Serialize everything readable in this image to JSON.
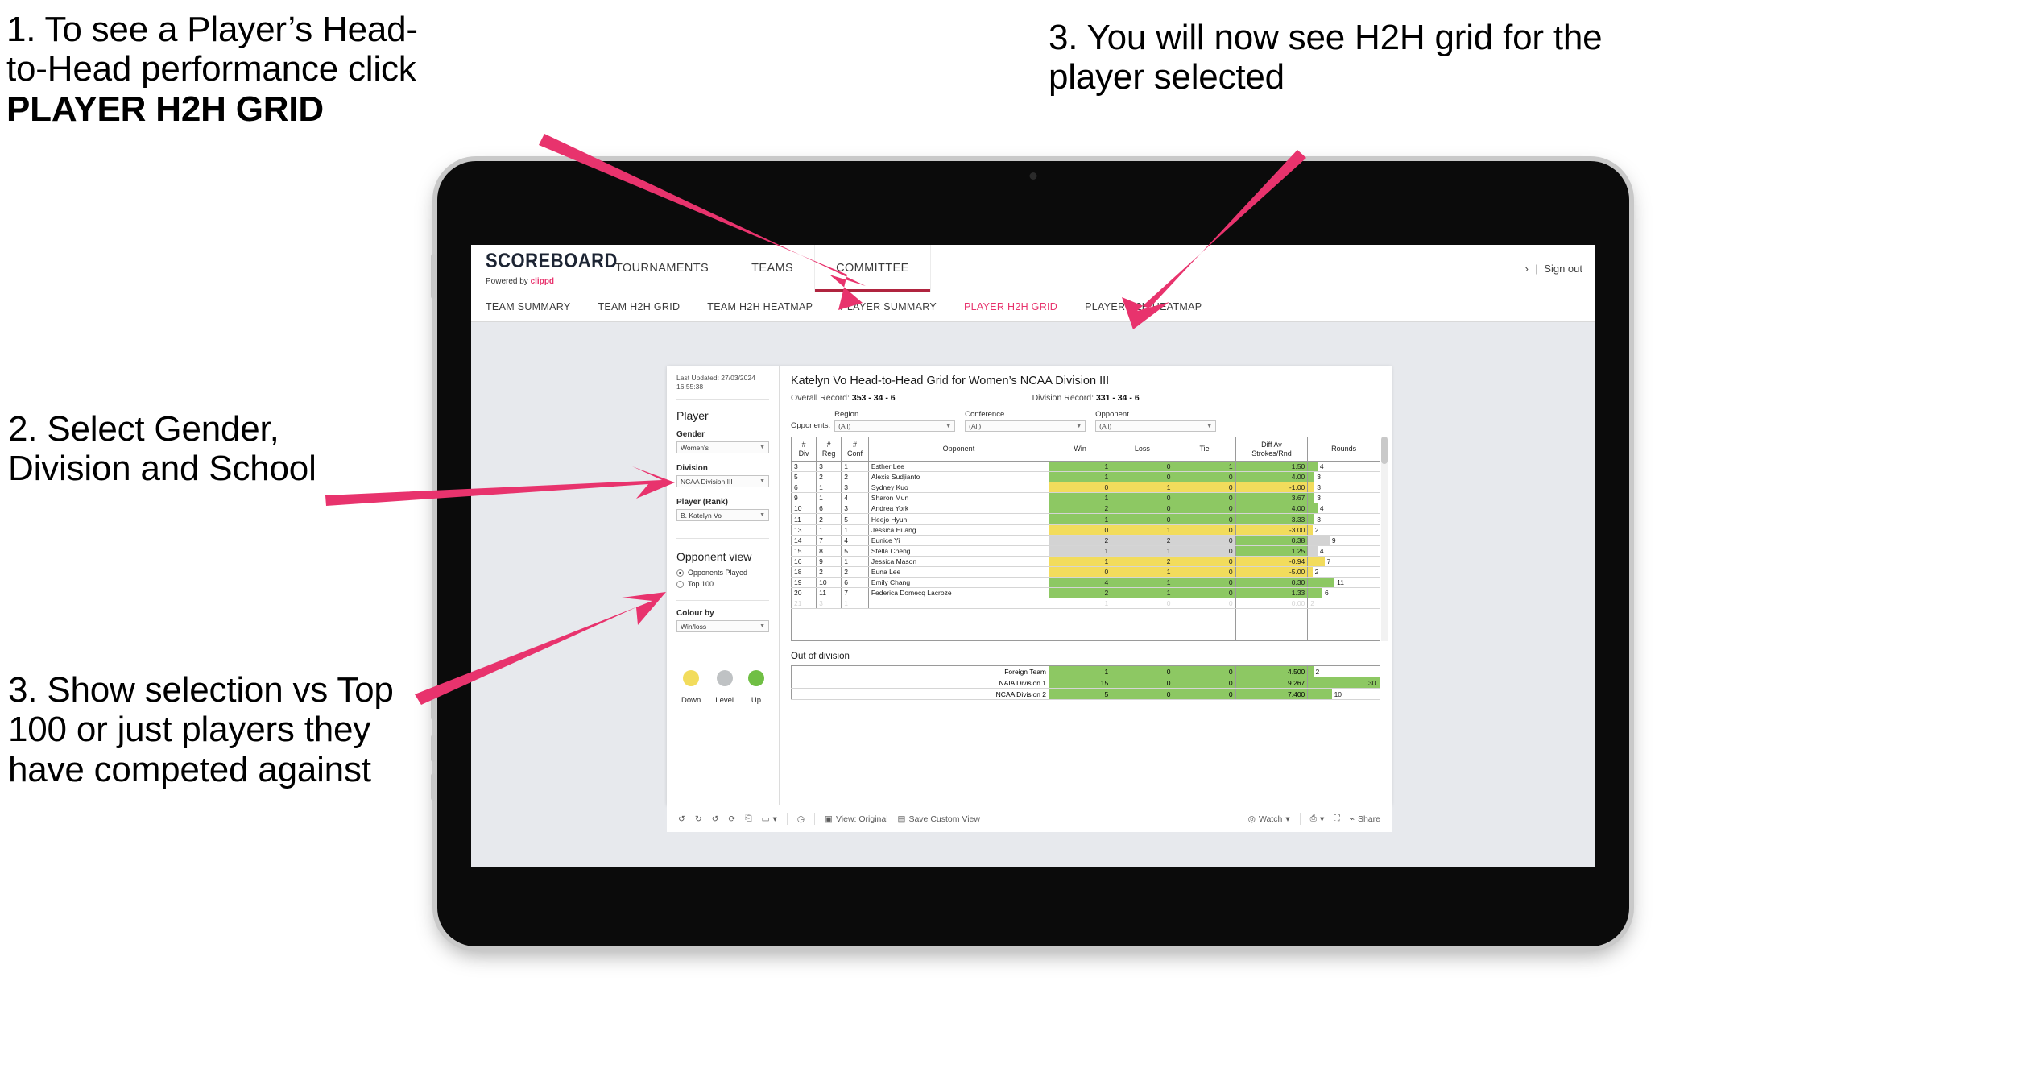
{
  "annotations": {
    "a1_line1": "1. To see a Player’s Head-",
    "a1_line2": "to-Head performance click",
    "a1_bold": "PLAYER H2H GRID",
    "a2": "2. Select Gender, Division and School",
    "a3": "3. Show selection vs Top 100 or just players they have competed against",
    "a4": "3. You will now see H2H grid for the player selected"
  },
  "app": {
    "brand": {
      "name": "SCOREBOARD",
      "powered_prefix": "Powered by ",
      "powered_brand": "clippd"
    },
    "topnav": [
      {
        "label": "TOURNAMENTS"
      },
      {
        "label": "TEAMS"
      },
      {
        "label": "COMMITTEE"
      }
    ],
    "account": {
      "chevron": "›",
      "separator": "|",
      "sign_out": "Sign out"
    },
    "subnav": [
      {
        "label": "TEAM SUMMARY",
        "selected": false
      },
      {
        "label": "TEAM H2H GRID",
        "selected": false
      },
      {
        "label": "TEAM H2H HEATMAP",
        "selected": false
      },
      {
        "label": "PLAYER SUMMARY",
        "selected": false
      },
      {
        "label": "PLAYER H2H GRID",
        "selected": true
      },
      {
        "label": "PLAYER H2H HEATMAP",
        "selected": false
      }
    ]
  },
  "sidebar": {
    "last_updated": "Last Updated: 27/03/2024 16:55:38",
    "player_heading": "Player",
    "gender": {
      "label": "Gender",
      "value": "Women's"
    },
    "division": {
      "label": "Division",
      "value": "NCAA Division III"
    },
    "player_rank": {
      "label": "Player (Rank)",
      "value": "B. Katelyn Vo"
    },
    "opponent_view": {
      "heading": "Opponent view",
      "options": [
        {
          "label": "Opponents Played",
          "selected": true
        },
        {
          "label": "Top 100",
          "selected": false
        }
      ]
    },
    "colour_by": {
      "label": "Colour by",
      "value": "Win/loss"
    },
    "legend": [
      {
        "label": "Down",
        "color": "#F2DC5C"
      },
      {
        "label": "Level",
        "color": "#BFC2C4"
      },
      {
        "label": "Up",
        "color": "#70BF44"
      }
    ]
  },
  "main": {
    "title": "Katelyn Vo Head-to-Head Grid for Women’s NCAA Division III",
    "overall_record_label": "Overall Record:",
    "overall_record_value": "353 -  34 - 6",
    "division_record_label": "Division Record:",
    "division_record_value": "331 -  34 - 6",
    "opponents_label": "Opponents:",
    "filters": [
      {
        "label": "Region",
        "value": "(All)"
      },
      {
        "label": "Conference",
        "value": "(All)"
      },
      {
        "label": "Opponent",
        "value": "(All)"
      }
    ],
    "columns": [
      "# Div",
      "# Reg",
      "# Conf",
      "Opponent",
      "Win",
      "Loss",
      "Tie",
      "Diff Av Strokes/Rnd",
      "Rounds"
    ],
    "rows": [
      {
        "div": "3",
        "reg": "3",
        "conf": "1",
        "opponent": "Esther Lee",
        "win": "1",
        "loss": "0",
        "tie": "1",
        "diff": "1.50",
        "rounds": "4",
        "color": "#8DC863",
        "bar_pct": 13
      },
      {
        "div": "5",
        "reg": "2",
        "conf": "2",
        "opponent": "Alexis Sudjianto",
        "win": "1",
        "loss": "0",
        "tie": "0",
        "diff": "4.00",
        "rounds": "3",
        "color": "#8DC863",
        "bar_pct": 9
      },
      {
        "div": "6",
        "reg": "1",
        "conf": "3",
        "opponent": "Sydney Kuo",
        "win": "0",
        "loss": "1",
        "tie": "0",
        "diff": "-1.00",
        "rounds": "3",
        "color": "#F2DC5C",
        "bar_pct": 9
      },
      {
        "div": "9",
        "reg": "1",
        "conf": "4",
        "opponent": "Sharon Mun",
        "win": "1",
        "loss": "0",
        "tie": "0",
        "diff": "3.67",
        "rounds": "3",
        "color": "#8DC863",
        "bar_pct": 9
      },
      {
        "div": "10",
        "reg": "6",
        "conf": "3",
        "opponent": "Andrea York",
        "win": "2",
        "loss": "0",
        "tie": "0",
        "diff": "4.00",
        "rounds": "4",
        "color": "#8DC863",
        "bar_pct": 13
      },
      {
        "div": "11",
        "reg": "2",
        "conf": "5",
        "opponent": "Heejo Hyun",
        "win": "1",
        "loss": "0",
        "tie": "0",
        "diff": "3.33",
        "rounds": "3",
        "color": "#8DC863",
        "bar_pct": 9
      },
      {
        "div": "13",
        "reg": "1",
        "conf": "1",
        "opponent": "Jessica Huang",
        "win": "0",
        "loss": "1",
        "tie": "0",
        "diff": "-3.00",
        "rounds": "2",
        "color": "#F2DC5C",
        "bar_pct": 6
      },
      {
        "div": "14",
        "reg": "7",
        "conf": "4",
        "opponent": "Eunice Yi",
        "win": "2",
        "loss": "2",
        "tie": "0",
        "diff": "0.38",
        "rounds": "9",
        "color": "#D3D3D3",
        "bar_pct": 30,
        "diff_color": "#8DC863"
      },
      {
        "div": "15",
        "reg": "8",
        "conf": "5",
        "opponent": "Stella Cheng",
        "win": "1",
        "loss": "1",
        "tie": "0",
        "diff": "1.25",
        "rounds": "4",
        "color": "#D3D3D3",
        "bar_pct": 13,
        "diff_color": "#8DC863"
      },
      {
        "div": "16",
        "reg": "9",
        "conf": "1",
        "opponent": "Jessica Mason",
        "win": "1",
        "loss": "2",
        "tie": "0",
        "diff": "-0.94",
        "rounds": "7",
        "color": "#F2DC5C",
        "bar_pct": 23
      },
      {
        "div": "18",
        "reg": "2",
        "conf": "2",
        "opponent": "Euna Lee",
        "win": "0",
        "loss": "1",
        "tie": "0",
        "diff": "-5.00",
        "rounds": "2",
        "color": "#F2DC5C",
        "bar_pct": 6
      },
      {
        "div": "19",
        "reg": "10",
        "conf": "6",
        "opponent": "Emily Chang",
        "win": "4",
        "loss": "1",
        "tie": "0",
        "diff": "0.30",
        "rounds": "11",
        "color": "#8DC863",
        "bar_pct": 37
      },
      {
        "div": "20",
        "reg": "11",
        "conf": "7",
        "opponent": "Federica Domecq Lacroze",
        "win": "2",
        "loss": "1",
        "tie": "0",
        "diff": "1.33",
        "rounds": "6",
        "color": "#8DC863",
        "bar_pct": 20
      }
    ],
    "out_of_division": {
      "heading": "Out of division",
      "rows": [
        {
          "name": "Foreign Team",
          "win": "1",
          "loss": "0",
          "tie": "0",
          "diff": "4.500",
          "rounds": "2",
          "color": "#8DC863",
          "bar_pct": 7
        },
        {
          "name": "NAIA Division 1",
          "win": "15",
          "loss": "0",
          "tie": "0",
          "diff": "9.267",
          "rounds": "30",
          "color": "#8DC863",
          "bar_pct": 100
        },
        {
          "name": "NCAA Division 2",
          "win": "5",
          "loss": "0",
          "tie": "0",
          "diff": "7.400",
          "rounds": "10",
          "color": "#8DC863",
          "bar_pct": 33
        }
      ]
    }
  },
  "toolbar": {
    "view_label": "View: Original",
    "save_label": "Save Custom View",
    "watch_label": "Watch",
    "share_label": "Share",
    "caret": "▾"
  },
  "colors": {
    "accent_pink": "#E8336D",
    "arrow_pink": "#E8336D",
    "green": "#8DC863",
    "yellow": "#F2DC5C",
    "grey": "#D3D3D3"
  }
}
